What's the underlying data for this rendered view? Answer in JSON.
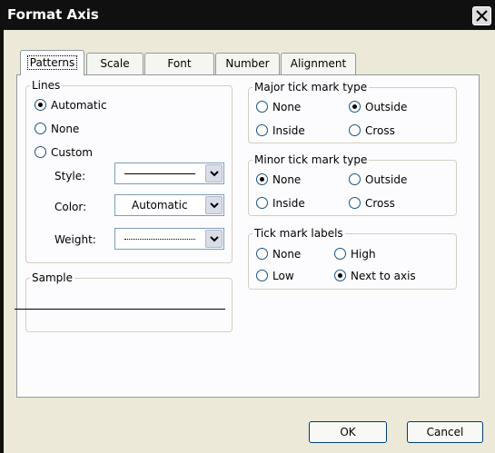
{
  "window": {
    "title": "Format Axis"
  },
  "tabs": [
    {
      "label": "Patterns",
      "active": true
    },
    {
      "label": "Scale",
      "active": false
    },
    {
      "label": "Font",
      "active": false
    },
    {
      "label": "Number",
      "active": false
    },
    {
      "label": "Alignment",
      "active": false
    }
  ],
  "lines": {
    "legend": "Lines",
    "automatic": "Automatic",
    "none": "None",
    "custom": "Custom",
    "selected": "automatic",
    "style_label": "Style:",
    "color_label": "Color:",
    "color_value": "Automatic",
    "weight_label": "Weight:"
  },
  "sample": {
    "legend": "Sample"
  },
  "major_tick": {
    "legend": "Major tick mark type",
    "none": "None",
    "outside": "Outside",
    "inside": "Inside",
    "cross": "Cross",
    "selected": "outside"
  },
  "minor_tick": {
    "legend": "Minor tick mark type",
    "none": "None",
    "outside": "Outside",
    "inside": "Inside",
    "cross": "Cross",
    "selected": "none"
  },
  "tick_labels": {
    "legend": "Tick mark labels",
    "none": "None",
    "high": "High",
    "low": "Low",
    "next_to_axis": "Next to axis",
    "selected": "next_to_axis"
  },
  "buttons": {
    "ok": "OK",
    "cancel": "Cancel"
  }
}
